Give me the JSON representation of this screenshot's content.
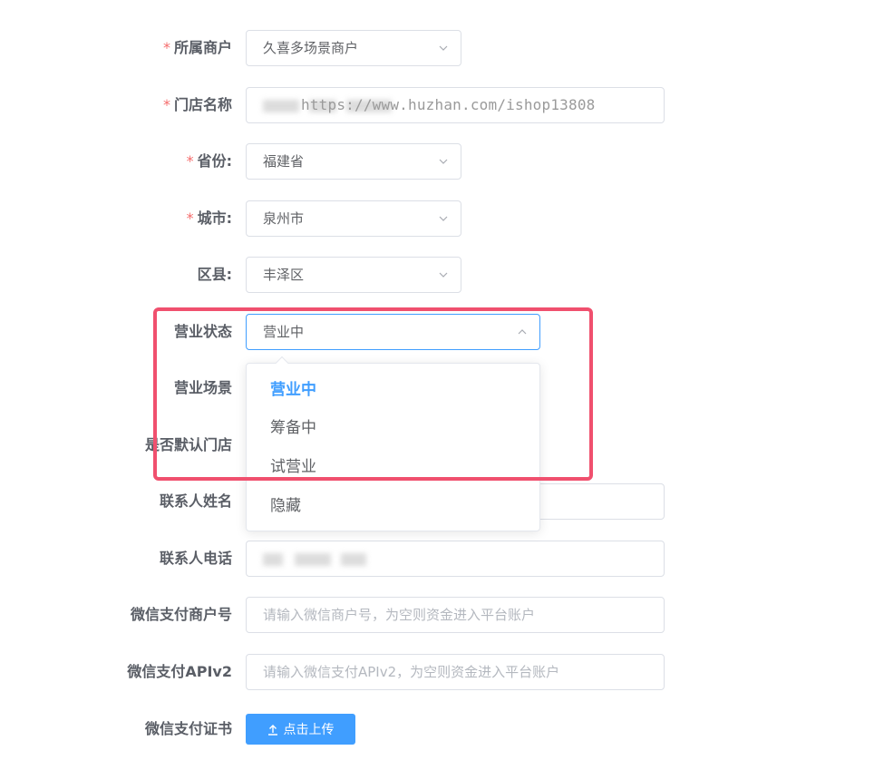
{
  "form": {
    "merchant": {
      "label": "所属商户",
      "value": "久喜多场景商户"
    },
    "store_name": {
      "label": "门店名称",
      "watermark": "https://www.huzhan.com/ishop13808"
    },
    "province": {
      "label": "省份:",
      "value": "福建省"
    },
    "city": {
      "label": "城市:",
      "value": "泉州市"
    },
    "district": {
      "label": "区县:",
      "value": "丰泽区"
    },
    "business_status": {
      "label": "营业状态",
      "value": "营业中",
      "options": [
        "营业中",
        "筹备中",
        "试营业",
        "隐藏"
      ]
    },
    "business_scene": {
      "label": "营业场景"
    },
    "default_store": {
      "label": "是否默认门店"
    },
    "contact_name": {
      "label": "联系人姓名"
    },
    "contact_phone": {
      "label": "联系人电话"
    },
    "wechat_merchant_id": {
      "label": "微信支付商户号",
      "placeholder": "请输入微信商户号，为空则资金进入平台账户"
    },
    "wechat_apiv2": {
      "label": "微信支付APIv2",
      "placeholder": "请输入微信支付APIv2，为空则资金进入平台账户"
    },
    "wechat_cert": {
      "label": "微信支付证书",
      "button_label": "点击上传"
    }
  },
  "colors": {
    "primary": "#409eff",
    "required": "#f56c6c",
    "highlight": "#f0506e"
  }
}
